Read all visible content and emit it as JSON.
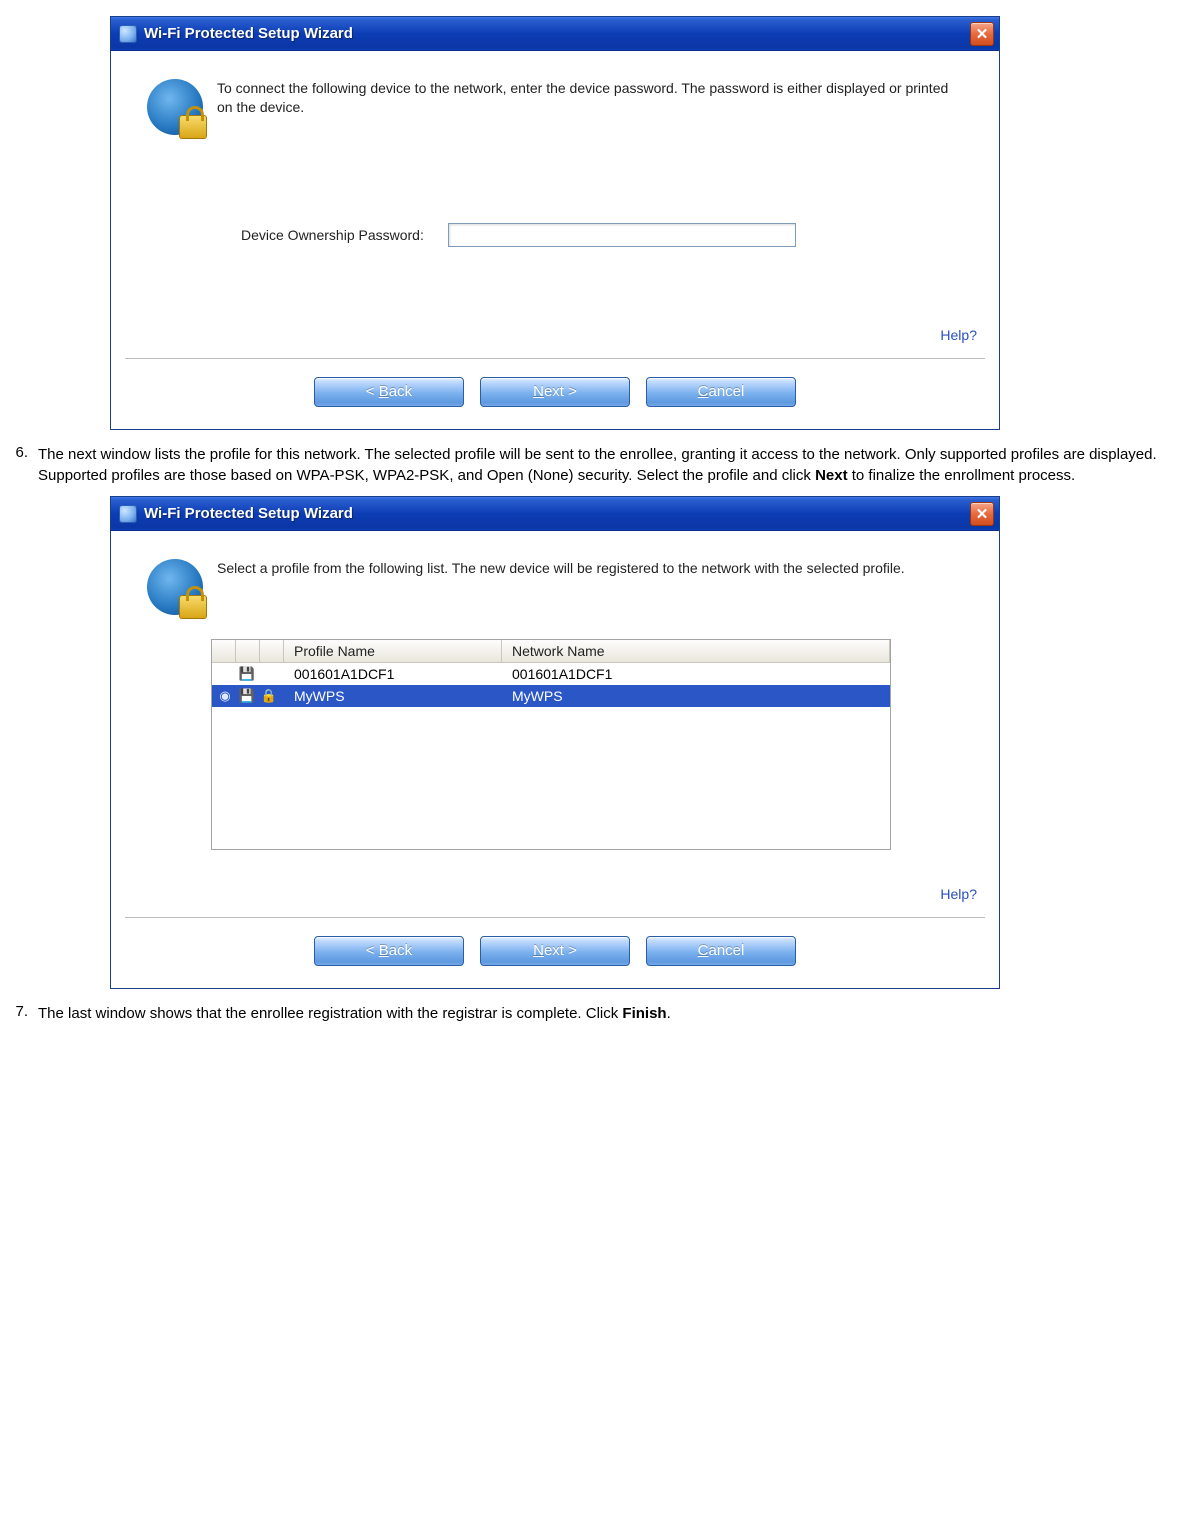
{
  "dialog1": {
    "title": "Wi-Fi Protected Setup Wizard",
    "info": "To connect the following device to the network, enter the device password. The password is either displayed or printed on the device.",
    "field_label": "Device Ownership Password:",
    "field_value": "",
    "help": "Help?",
    "buttons": {
      "back": "< Back",
      "next": "Next >",
      "cancel": "Cancel"
    },
    "back_u": "B",
    "next_u": "N",
    "cancel_u": "C"
  },
  "step6": {
    "num": "6.",
    "text_a": "The next window lists the profile for this network. The selected profile will be sent to the enrollee, granting it access to the network. Only supported profiles are displayed. Supported profiles are those based on WPA-PSK, WPA2-PSK, and Open (None) security. Select the profile and click ",
    "text_bold": "Next",
    "text_b": " to finalize the enrollment process."
  },
  "dialog2": {
    "title": "Wi-Fi Protected Setup Wizard",
    "info": "Select a profile from the following list. The new device will be registered to the network with the selected profile.",
    "columns": {
      "pname": "Profile Name",
      "nname": "Network Name"
    },
    "rows": [
      {
        "pname": "001601A1DCF1",
        "nname": "001601A1DCF1",
        "selected": false,
        "has_signal": false,
        "has_lock": false
      },
      {
        "pname": "MyWPS",
        "nname": "MyWPS",
        "selected": true,
        "has_signal": true,
        "has_lock": true
      }
    ],
    "help": "Help?",
    "buttons": {
      "back": "< Back",
      "next": "Next >",
      "cancel": "Cancel"
    }
  },
  "step7": {
    "num": "7.",
    "text_a": "The last window shows that the enrollee registration with the registrar is complete. Click ",
    "text_bold": "Finish",
    "text_b": "."
  }
}
